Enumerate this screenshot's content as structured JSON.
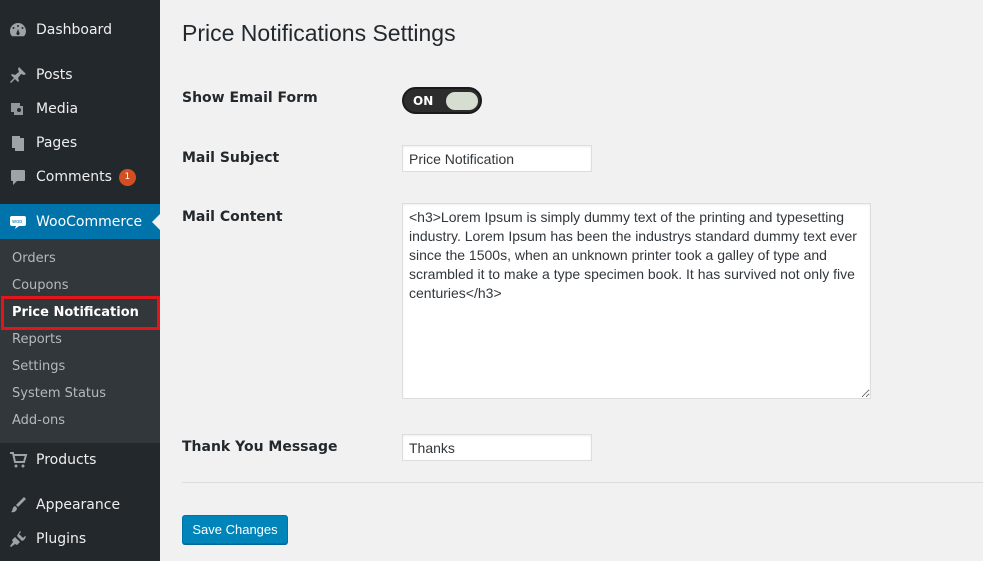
{
  "sidebar": {
    "items": [
      {
        "label": "Dashboard",
        "icon": "dashboard-icon"
      },
      {
        "label": "Posts",
        "icon": "pin-icon"
      },
      {
        "label": "Media",
        "icon": "media-icon"
      },
      {
        "label": "Pages",
        "icon": "pages-icon"
      },
      {
        "label": "Comments",
        "icon": "comment-icon",
        "badge": "1"
      },
      {
        "label": "WooCommerce",
        "icon": "woocommerce-icon",
        "active": true
      },
      {
        "label": "Products",
        "icon": "cart-icon"
      },
      {
        "label": "Appearance",
        "icon": "brush-icon"
      },
      {
        "label": "Plugins",
        "icon": "plugin-icon"
      }
    ],
    "submenu": [
      {
        "label": "Orders"
      },
      {
        "label": "Coupons"
      },
      {
        "label": "Price Notification",
        "current": true
      },
      {
        "label": "Reports"
      },
      {
        "label": "Settings"
      },
      {
        "label": "System Status"
      },
      {
        "label": "Add-ons"
      }
    ]
  },
  "page": {
    "title": "Price Notifications Settings",
    "fields": {
      "show_email_form": {
        "label": "Show Email Form",
        "toggle_text": "ON",
        "value": true
      },
      "mail_subject": {
        "label": "Mail Subject",
        "value": "Price Notification"
      },
      "mail_content": {
        "label": "Mail Content",
        "value": "<h3>Lorem Ipsum is simply dummy text of the printing and typesetting industry. Lorem Ipsum has been the industrys standard dummy text ever since the 1500s, when an unknown printer took a galley of type and scrambled it to make a type specimen book. It has survived not only five centuries</h3>"
      },
      "thank_you_message": {
        "label": "Thank You Message",
        "value": "Thanks"
      }
    },
    "save_button": "Save Changes"
  },
  "colors": {
    "sidebar_bg": "#23282d",
    "submenu_bg": "#32373c",
    "active": "#0073aa",
    "button": "#0085ba",
    "highlight": "#e0161b",
    "badge": "#d54e21"
  }
}
